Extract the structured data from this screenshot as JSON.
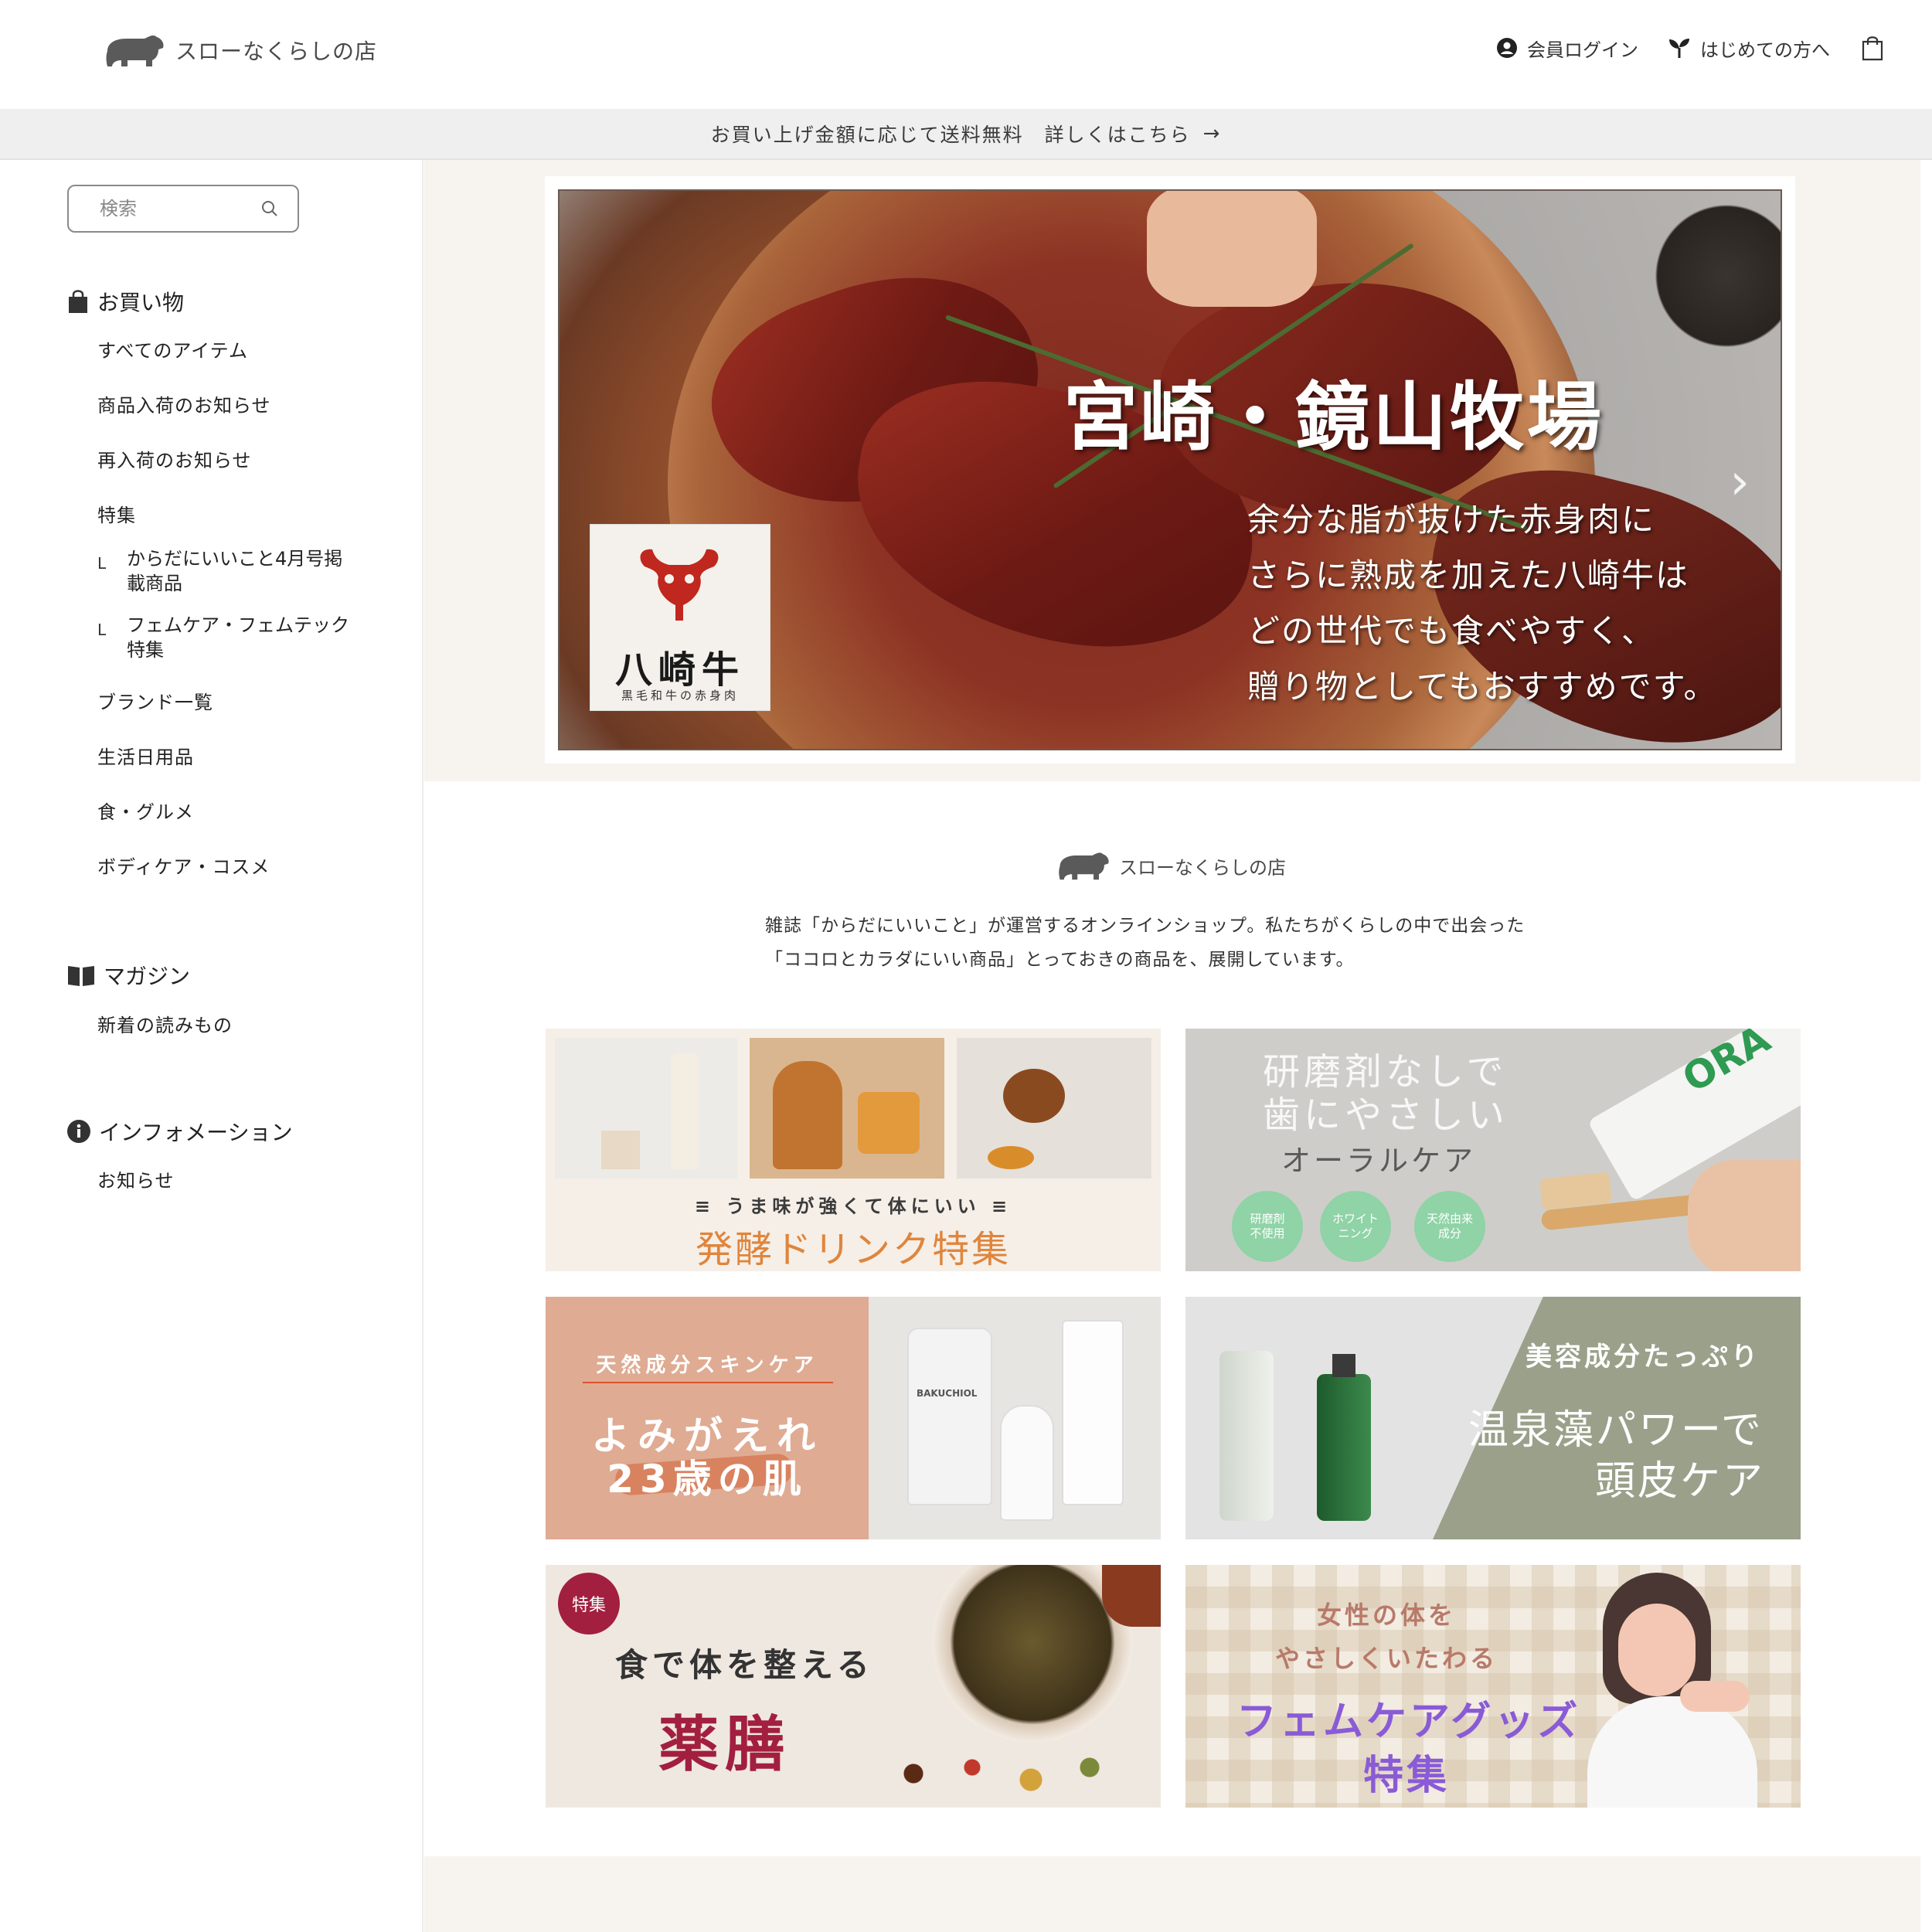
{
  "header": {
    "logo_text": "スローなくらしの店",
    "login": "会員ログイン",
    "first_time": "はじめての方へ"
  },
  "announcement": {
    "text": "お買い上げ金額に応じて送料無料　詳しくはこちら",
    "arrow": "→"
  },
  "sidebar": {
    "search_placeholder": "検索",
    "shopping": {
      "title": "お買い物",
      "items": [
        "すべてのアイテム",
        "商品入荷のお知らせ",
        "再入荷のお知らせ",
        "特集"
      ],
      "sub_items": [
        {
          "line1": "からだにいいこと4月号掲",
          "line2": "載商品"
        },
        {
          "line1": "フェムケア・フェムテック",
          "line2": "特集"
        }
      ],
      "items_after": [
        "ブランド一覧",
        "生活日用品",
        "食・グルメ",
        "ボディケア・コスメ"
      ]
    },
    "magazine": {
      "title": "マガジン",
      "items": [
        "新着の読みもの"
      ]
    },
    "information": {
      "title": "インフォメーション",
      "items": [
        "お知らせ"
      ]
    },
    "corner_mark": "L"
  },
  "hero": {
    "title": "宮崎・鏡山牧場",
    "lines": [
      "余分な脂が抜けた赤身肉に",
      "さらに熟成を加えた八崎牛は",
      "どの世代でも食べやすく、",
      "贈り物としてもおすすめです。"
    ],
    "brand_name": "八崎牛",
    "brand_sub": "黒毛和牛の赤身肉",
    "next": "›"
  },
  "intro": {
    "logo_text": "スローなくらしの店",
    "line1": "雑誌「からだにいいこと」が運営するオンラインショップ。私たちがくらしの中で出会った",
    "line2": "「ココロとカラダにいい商品」とっておきの商品を、展開しています。"
  },
  "banners": {
    "b1": {
      "tagline": "うま味が強くて体にいい",
      "title": "発酵ドリンク特集"
    },
    "b2": {
      "line1": "研磨剤なしで",
      "line2": "歯にやさしい",
      "line3": "オーラルケア",
      "badges": [
        "研磨剤\n不使用",
        "ホワイト\nニング",
        "天然由来\n成分"
      ],
      "brand": "ORA"
    },
    "b3": {
      "line1": "天然成分スキンケア",
      "line2": "よみがえれ",
      "line3": "23歳の肌",
      "product": "BAKUCHIOL"
    },
    "b4": {
      "line1": "美容成分たっぷり",
      "line2": "温泉藻パワーで",
      "line3": "頭皮ケア"
    },
    "b5": {
      "badge": "特集",
      "line1": "食で体を整える",
      "line2": "薬膳"
    },
    "b6": {
      "line1": "女性の体を",
      "line2": "やさしくいたわる",
      "line3": "フェムケアグッズ",
      "line4": "特集"
    }
  },
  "colors": {
    "band_beige": "#f7f3ef",
    "announce_gray": "#efefef",
    "fermented_orange": "#e0853c",
    "mint": "#8fd3a6",
    "salmon": "#dfab92",
    "sage": "#9aa08a",
    "crimson": "#a21f3f",
    "purple": "#8a5bd6"
  }
}
